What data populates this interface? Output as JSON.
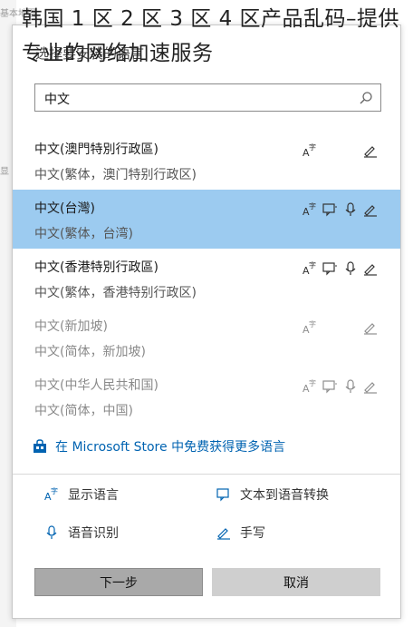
{
  "overlay_title": "韩国 1 区 2 区 3 区 4 区产品乱码–提供专业的网络加速服务",
  "background": {
    "fragment_top": "基本地图",
    "fragment_mid": "显"
  },
  "dialog": {
    "header": "选择要安装的语言",
    "search": {
      "value": "中文"
    },
    "languages": [
      {
        "title": "中文(澳門特別行政區)",
        "subtitle": "中文(繁体，澳门特别行政区)",
        "selected": false,
        "dim": false,
        "features": [
          "display",
          "handwriting"
        ]
      },
      {
        "title": "中文(台灣)",
        "subtitle": "中文(繁体，台湾)",
        "selected": true,
        "dim": false,
        "features": [
          "display",
          "tts",
          "speech",
          "handwriting"
        ]
      },
      {
        "title": "中文(香港特別行政區)",
        "subtitle": "中文(繁体，香港特别行政区)",
        "selected": false,
        "dim": false,
        "features": [
          "display",
          "tts",
          "speech",
          "handwriting"
        ]
      },
      {
        "title": "中文(新加坡)",
        "subtitle": "中文(简体，新加坡)",
        "selected": false,
        "dim": true,
        "features": [
          "display",
          "handwriting"
        ]
      },
      {
        "title": "中文(中华人民共和国)",
        "subtitle": "中文(简体，中国)",
        "selected": false,
        "dim": true,
        "features": [
          "display",
          "tts",
          "speech",
          "handwriting"
        ]
      }
    ],
    "store_link": "在 Microsoft Store 中免费获得更多语言",
    "legend": {
      "display": "显示语言",
      "tts": "文本到语音转换",
      "speech": "语音识别",
      "handwriting": "手写"
    },
    "buttons": {
      "next": "下一步",
      "cancel": "取消"
    }
  },
  "colors": {
    "selected_row": "#9ccbf0",
    "link": "#0063b1",
    "next_button": "#a9a9a9",
    "cancel_button": "#cfcfcf"
  }
}
